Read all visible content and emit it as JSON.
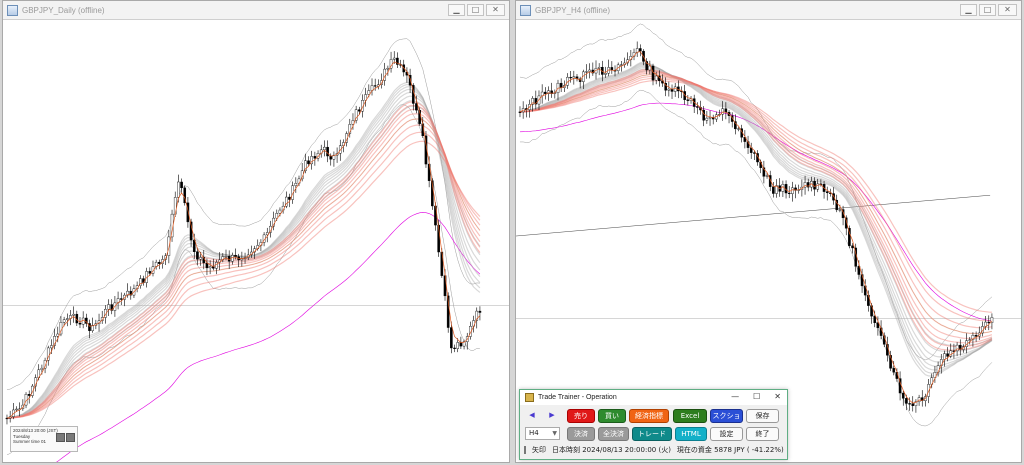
{
  "left_window": {
    "title": "GBPJPY_Daily (offline)"
  },
  "right_window": {
    "title": "GBPJPY_H4 (offline)"
  },
  "window_buttons": {
    "minimize": "▁",
    "maximize": "□",
    "close": "✕"
  },
  "mini_panel": {
    "lines": [
      "2024/8/13 20:00 (JST)",
      "Tuesday",
      "Summer time   01"
    ]
  },
  "dialog": {
    "title": "Trade Trainer - Operation",
    "controls": {
      "minimize": "—",
      "maximize": "☐",
      "close": "✕"
    },
    "nav": {
      "prev": "◀",
      "next": "▶"
    },
    "buttons": {
      "sell": "売り",
      "buy": "買い",
      "indicators": "経済指標",
      "excel": "Excel",
      "screenshot": "スクショ",
      "save": "保存",
      "settle": "決済",
      "settle_all": "全決済",
      "trade": "トレード",
      "html": "HTML",
      "settings": "設定",
      "quit": "終了"
    },
    "timeframe": "H4",
    "status": {
      "arrow_label": "矢印",
      "time_text": "日本時刻 2024/08/13 20:00:00 (火)",
      "funds_text": "現在の資金 5878 JPY ( -41.22%)"
    },
    "colors": {
      "sell": "#e01818",
      "buy": "#2e8b2e",
      "indicators": "#f06414",
      "excel": "#2e7d1e",
      "screenshot": "#2b4fd6",
      "teal": "#0f8a8a",
      "gray": "#9a9a9a",
      "html": "#12b0c8"
    }
  }
}
